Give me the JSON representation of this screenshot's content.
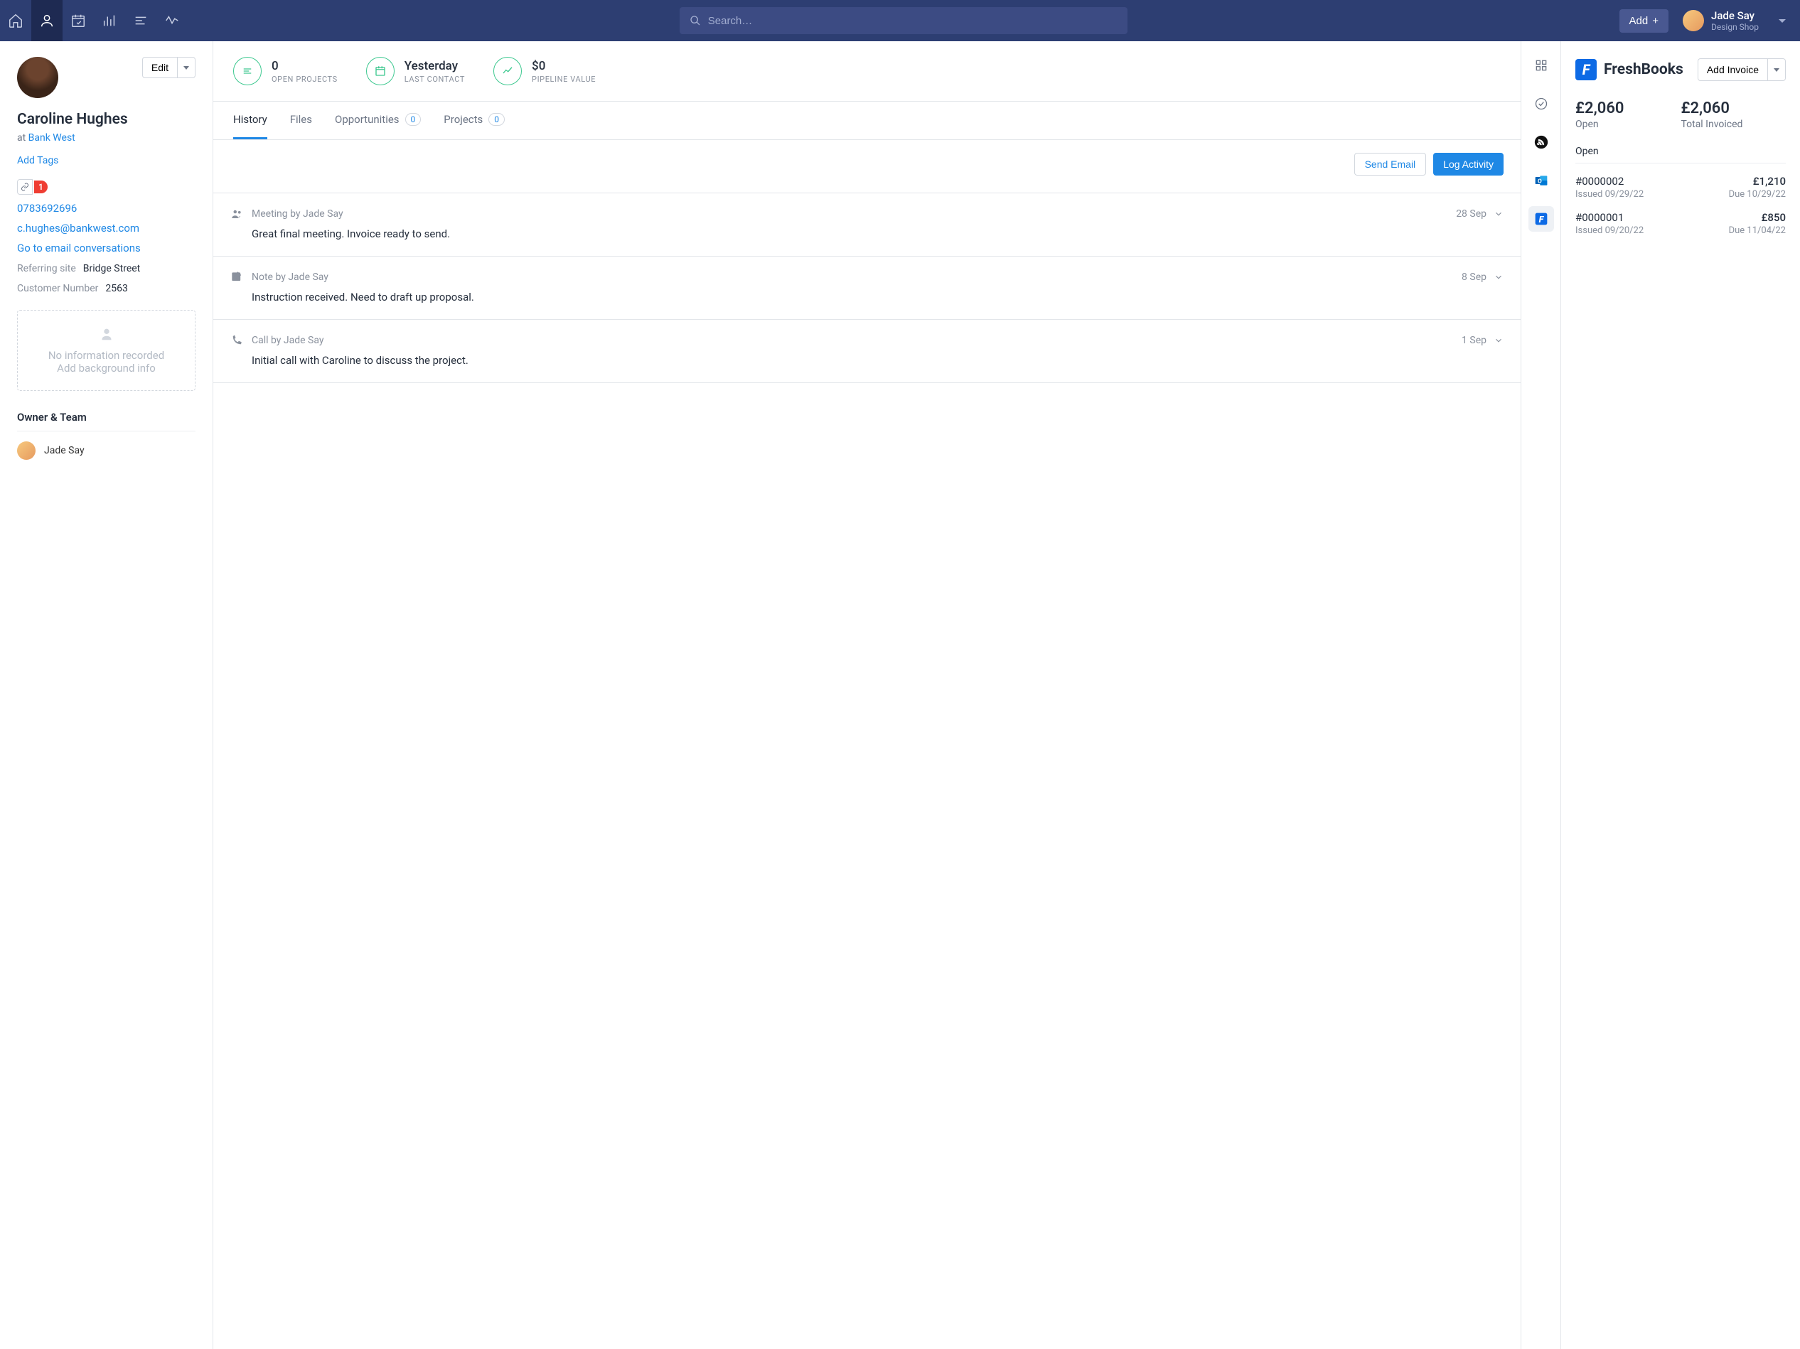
{
  "topnav": {
    "search_placeholder": "Search…",
    "add_label": "Add",
    "user_name": "Jade Say",
    "user_org": "Design Shop"
  },
  "contact": {
    "edit_label": "Edit",
    "name": "Caroline Hughes",
    "at_prefix": "at ",
    "company": "Bank West",
    "add_tags": "Add Tags",
    "link_count": "1",
    "phone": "0783692696",
    "email": "c.hughes@bankwest.com",
    "email_conv": "Go to email conversations",
    "referring_site_label": "Referring site",
    "referring_site_value": "Bridge Street",
    "customer_number_label": "Customer Number",
    "customer_number_value": "2563",
    "bg_line1": "No information recorded",
    "bg_line2": "Add background info",
    "owner_team_title": "Owner & Team",
    "owner_name": "Jade Say"
  },
  "stats": {
    "open_projects_val": "0",
    "open_projects_lbl": "OPEN PROJECTS",
    "last_contact_val": "Yesterday",
    "last_contact_lbl": "LAST CONTACT",
    "pipeline_val": "$0",
    "pipeline_lbl": "PIPELINE VALUE"
  },
  "tabs": {
    "history": "History",
    "files": "Files",
    "opportunities": "Opportunities",
    "opportunities_count": "0",
    "projects": "Projects",
    "projects_count": "0"
  },
  "actions": {
    "send_email": "Send Email",
    "log_activity": "Log Activity"
  },
  "activities": [
    {
      "type": "Meeting by Jade Say",
      "date": "28 Sep",
      "body": "Great final meeting. Invoice ready to send."
    },
    {
      "type": "Note by Jade Say",
      "date": "8 Sep",
      "body": "Instruction received. Need to draft up proposal."
    },
    {
      "type": "Call by Jade Say",
      "date": "1 Sep",
      "body": "Initial call with Caroline to discuss the project."
    }
  ],
  "freshbooks": {
    "brand": "FreshBooks",
    "add_invoice": "Add Invoice",
    "open_total": "£2,060",
    "open_label": "Open",
    "invoiced_total": "£2,060",
    "invoiced_label": "Total Invoiced",
    "open_section": "Open",
    "invoices": [
      {
        "num": "#0000002",
        "issued": "Issued 09/29/22",
        "amt": "£1,210",
        "due": "Due 10/29/22"
      },
      {
        "num": "#0000001",
        "issued": "Issued 09/20/22",
        "amt": "£850",
        "due": "Due 11/04/22"
      }
    ]
  }
}
